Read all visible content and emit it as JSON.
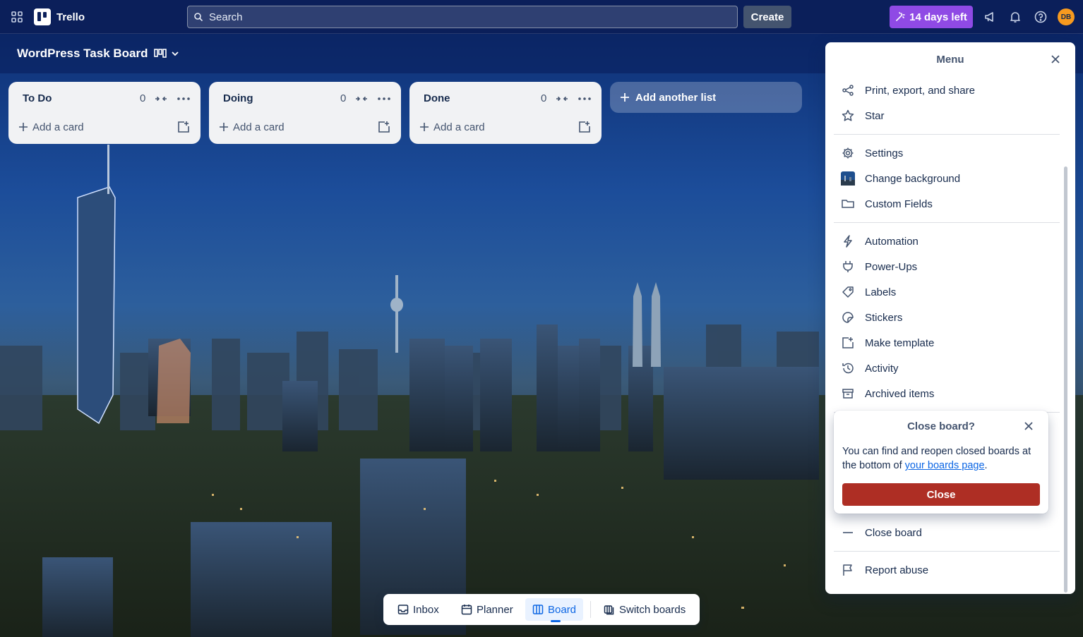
{
  "topnav": {
    "app_name": "Trello",
    "search_placeholder": "Search",
    "create_label": "Create",
    "trial_label": "14 days left",
    "avatar_initials": "DB"
  },
  "board": {
    "title": "WordPress Task Board"
  },
  "lists": [
    {
      "title": "To Do",
      "count": "0",
      "add_card": "Add a card"
    },
    {
      "title": "Doing",
      "count": "0",
      "add_card": "Add a card"
    },
    {
      "title": "Done",
      "count": "0",
      "add_card": "Add a card"
    }
  ],
  "add_list_label": "Add another list",
  "menu": {
    "title": "Menu",
    "items": [
      {
        "label": "Print, export, and share",
        "icon": "share-icon"
      },
      {
        "label": "Star",
        "icon": "star-icon"
      },
      {
        "label": "Settings",
        "icon": "gear-icon"
      },
      {
        "label": "Change background",
        "icon": "background-thumbnail-icon"
      },
      {
        "label": "Custom Fields",
        "icon": "custom-fields-icon"
      },
      {
        "label": "Automation",
        "icon": "lightning-icon"
      },
      {
        "label": "Power-Ups",
        "icon": "plug-icon"
      },
      {
        "label": "Labels",
        "icon": "tag-icon"
      },
      {
        "label": "Stickers",
        "icon": "sticker-icon"
      },
      {
        "label": "Make template",
        "icon": "template-icon"
      },
      {
        "label": "Activity",
        "icon": "history-icon"
      },
      {
        "label": "Archived items",
        "icon": "archive-icon"
      },
      {
        "label": "Close board",
        "icon": "minus-icon"
      },
      {
        "label": "Report abuse",
        "icon": "flag-icon"
      }
    ]
  },
  "close_popover": {
    "title": "Close board?",
    "text_before": "You can find and reopen closed boards at the bottom of ",
    "link_text": "your boards page",
    "text_after": ".",
    "button_label": "Close",
    "button_color": "#ae2e24"
  },
  "bottomnav": {
    "inbox": "Inbox",
    "planner": "Planner",
    "board": "Board",
    "switch": "Switch boards"
  },
  "colors": {
    "nav_bg": "#0b1f5a",
    "trial": "#8f4ae5",
    "avatar": "#f79a1f",
    "accent": "#0c66e4"
  }
}
